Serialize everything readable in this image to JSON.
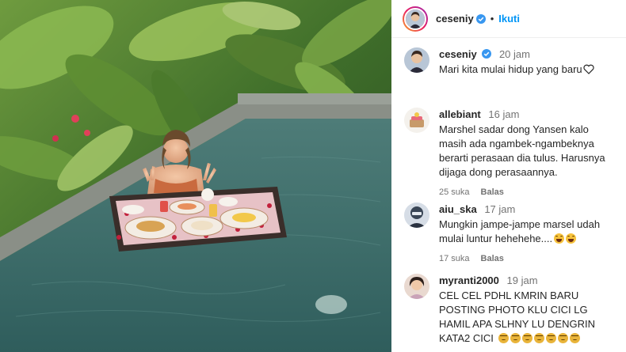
{
  "header": {
    "username": "ceseniy",
    "follow_label": "Ikuti",
    "separator": "•"
  },
  "caption": {
    "username": "ceseniy",
    "time": "20 jam",
    "text": "Mari kita mulai hidup yang baru"
  },
  "comments": [
    {
      "username": "allebiant",
      "time": "16 jam",
      "text": "Marshel sadar dong Yansen kalo masih ada ngambek-ngambeknya berarti perasaan dia tulus. Harusnya dijaga dong perasaannya.",
      "likes": "25 suka",
      "reply_label": "Balas"
    },
    {
      "username": "aiu_ska",
      "time": "17 jam",
      "text": "Mungkin jampe-jampe marsel udah mulai luntur hehehehe....",
      "likes": "17 suka",
      "reply_label": "Balas"
    },
    {
      "username": "myranti2000",
      "time": "19 jam",
      "text": "CEL CEL PDHL KMRIN BARU POSTING PHOTO KLU CICI LG HAMIL APA SLHNY LU DENGRIN KATA2 CICI"
    }
  ],
  "colors": {
    "accent": "#0095f6",
    "verified": "#3897f0",
    "muted": "#737373",
    "text": "#262626"
  },
  "icons": [
    "verified-badge-icon",
    "heart-icon",
    "laughing-emoji-icon",
    "angry-emoji-icon"
  ]
}
